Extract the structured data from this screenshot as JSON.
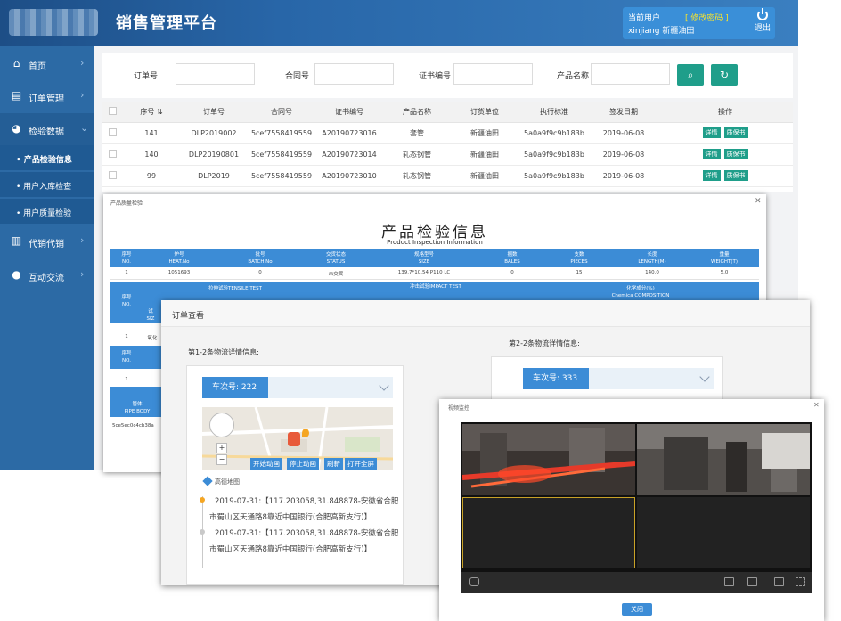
{
  "app": {
    "title": "销售管理平台",
    "current_user_label": "当前用户",
    "change_password": "[ 修改密码 ]",
    "user_name": "xinjiang 新疆油田",
    "logout": "退出"
  },
  "sidebar": {
    "items": [
      {
        "label": "首页",
        "icon": "home-icon"
      },
      {
        "label": "订单管理",
        "icon": "document-icon"
      },
      {
        "label": "检验数据",
        "icon": "pie-chart-icon"
      },
      {
        "label": "代销代销",
        "icon": "bar-chart-icon"
      },
      {
        "label": "互动交流",
        "icon": "chat-icon"
      }
    ],
    "sub_items": [
      "• 产品检验信息",
      "• 用户入库检查",
      "• 用户质量检验"
    ]
  },
  "filter": {
    "order_no": "订单号",
    "contract_no": "合同号",
    "cert_no": "证书编号",
    "product_name": "产品名称"
  },
  "table": {
    "headers": [
      "序号 ⇅",
      "订单号",
      "合同号",
      "证书编号",
      "产品名称",
      "订货单位",
      "执行标准",
      "签发日期",
      "操作"
    ],
    "rows": [
      [
        "141",
        "DLP2019002",
        "5cef7558419559",
        "A20190723016",
        "套管",
        "新疆油田",
        "5a0a9f9c9b183b",
        "2019-06-08"
      ],
      [
        "140",
        "DLP20190801",
        "5cef7558419559",
        "A20190723014",
        "轧态钢管",
        "新疆油田",
        "5a0a9f9c9b183b",
        "2019-06-08"
      ],
      [
        "99",
        "DLP2019",
        "5cef7558419559",
        "A20190723010",
        "轧态钢管",
        "新疆油田",
        "5a0a9f9c9b183b",
        "2019-06-08"
      ]
    ],
    "detail": "详情",
    "quality": "质保书"
  },
  "dlg1": {
    "title": "产品质量检验",
    "heading": "产品检验信息",
    "heading_en": "Product Inspection Information",
    "headers": [
      [
        "序号",
        "NO."
      ],
      [
        "炉号",
        "HEAT.No"
      ],
      [
        "批号",
        "BATCH.No"
      ],
      [
        "交货状态",
        "STATUS"
      ],
      [
        "规格型号",
        "SIZE"
      ],
      [
        "捆数",
        "BALES"
      ],
      [
        "支数",
        "PIECES"
      ],
      [
        "长度",
        "LENGTH(M)"
      ],
      [
        "重量",
        "WEIGHT(T)"
      ]
    ],
    "row": [
      "1",
      "1051693",
      "0",
      "未交货",
      "139.7*10.54 P110 LC",
      "0",
      "15",
      "140.0",
      "5.0"
    ],
    "tensile": "拉伸试验TENSILE TEST",
    "impact": "冲击试验IMPACT TEST",
    "chem_cn": "化学成分(%)",
    "chem_en": "Chemica COMPOSITION",
    "no_cn": "序号",
    "no_en": "NO.",
    "frag_size": "SIZ",
    "frag_test": "试",
    "row2_no": "1",
    "row2_txt": "氧化",
    "row3_no": "1",
    "pipe_cn": "管体",
    "pipe_en": "PIPE BODY",
    "hash": "5ce5ec0c4cb38a"
  },
  "dlg2": {
    "title": "订单查看",
    "left_title": "第1-2条物流详情信息:",
    "right_title": "第2-2条物流详情信息:",
    "car_left": "车次号: 222",
    "car_right": "车次号: 333",
    "map_buttons": [
      "开始动画",
      "停止动画",
      "刷新",
      "打开全屏"
    ],
    "map_brand": "高德地图",
    "log1a": "2019-07-31:【117.203058,31.848878-安徽省合肥",
    "log1b": "市蜀山区天通路8靠近中国银行(合肥高新支行)】",
    "log2a": "2019-07-31:【117.203058,31.848878-安徽省合肥",
    "log2b": "市蜀山区天通路8靠近中国银行(合肥高新支行)】"
  },
  "dlg3": {
    "title": "视频监控",
    "close": "关闭"
  },
  "colors": {
    "brand_blue": "#2c6aa5",
    "accent_teal": "#1f9e8a",
    "header_blue": "#3c8cd6",
    "password_yellow": "#f8e32c"
  }
}
